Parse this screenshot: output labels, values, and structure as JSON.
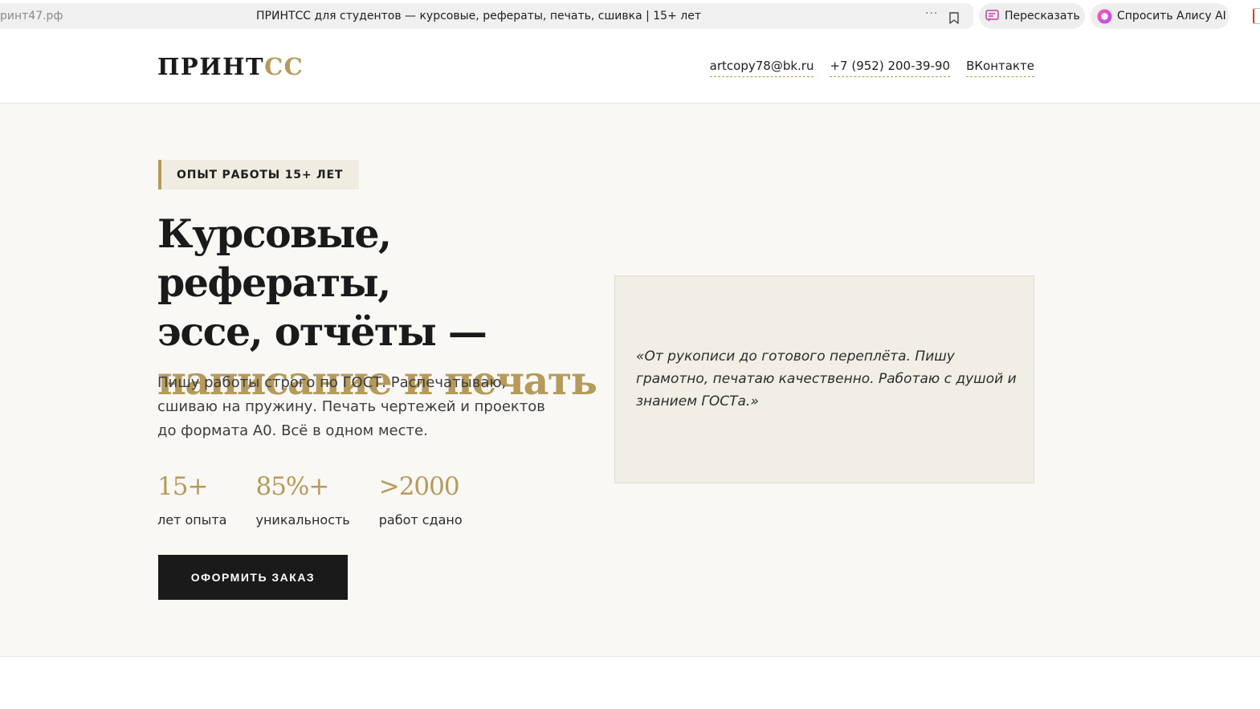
{
  "browser": {
    "url": "ринт47.рф",
    "page_title": "ПРИНТСС для студентов — курсовые, рефераты, печать, сшивка | 15+ лет",
    "more_label": "···",
    "retell_label": "Пересказать",
    "alice_label": "Спросить Алису AI"
  },
  "header": {
    "logo_dark": "ПРИНТ",
    "logo_gold": "СС",
    "nav": [
      {
        "label": "artcopy78@bk.ru"
      },
      {
        "label": "+7 (952) 200-39-90"
      },
      {
        "label": "ВКонтакте"
      }
    ]
  },
  "hero": {
    "badge": "ОПЫТ РАБОТЫ 15+ ЛЕТ",
    "headline_line1": "Курсовые, рефераты,",
    "headline_line2": "эссе, отчёты —",
    "headline_highlight": "написание и печать",
    "lead": "Пишу работы строго по ГОСТ. Распечатываю, сшиваю на пружину. Печать чертежей и проектов до формата А0. Всё в одном месте.",
    "stats": [
      {
        "value": "15+",
        "label": "лет опыта"
      },
      {
        "value": "85%+",
        "label": "уникальность"
      },
      {
        "value": ">2000",
        "label": "работ сдано"
      }
    ],
    "cta_label": "ОФОРМИТЬ ЗАКАЗ",
    "quote": "«От рукописи до готового переплёта. Пишу грамотно, печатаю качественно. Работаю с душой и знанием ГОСТа.»"
  },
  "colors": {
    "accent_gold": "#b59a5b",
    "text_dark": "#1a1a1a",
    "hero_bg": "#f9f8f5",
    "quote_bg": "#f1eee6",
    "cta_bg": "#1a1a1a"
  }
}
